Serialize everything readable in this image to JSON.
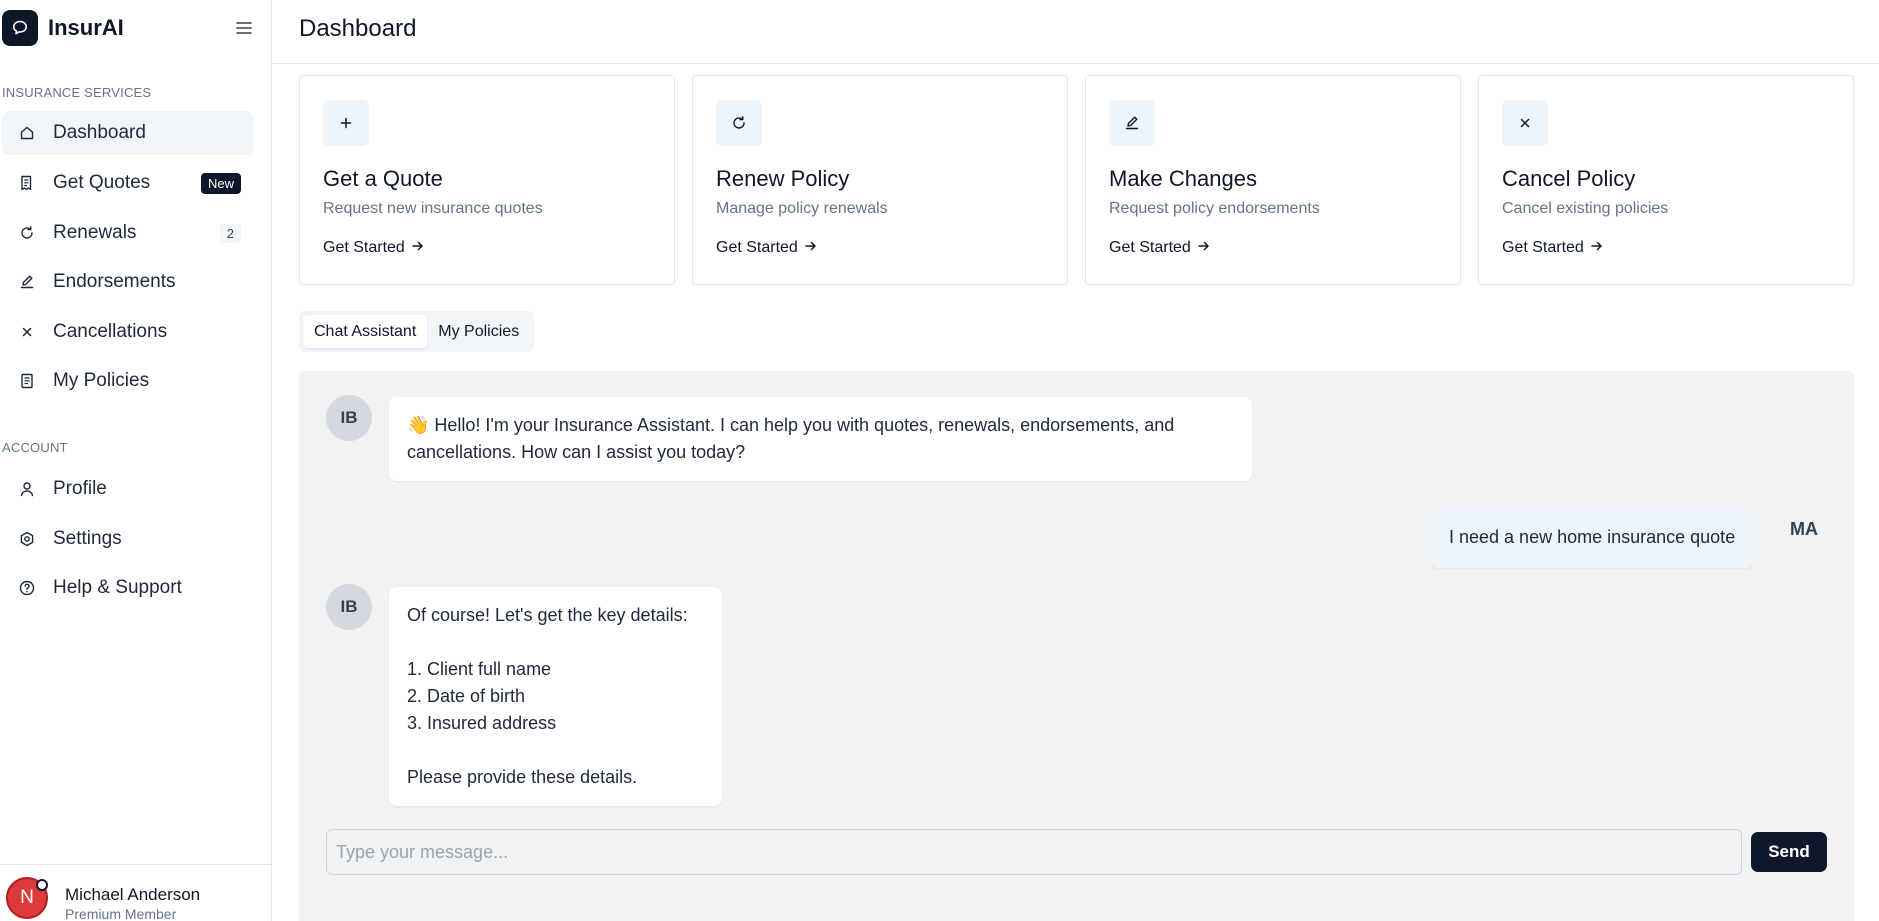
{
  "app": {
    "name": "InsurAI"
  },
  "sidebar": {
    "sections": [
      {
        "label": "INSURANCE SERVICES"
      },
      {
        "label": "ACCOUNT"
      }
    ],
    "items": [
      {
        "label": "Dashboard",
        "icon": "home-icon"
      },
      {
        "label": "Get Quotes",
        "icon": "receipt-icon",
        "badge": "New"
      },
      {
        "label": "Renewals",
        "icon": "refresh-icon",
        "badge": "2"
      },
      {
        "label": "Endorsements",
        "icon": "pencil-icon"
      },
      {
        "label": "Cancellations",
        "icon": "x-icon"
      },
      {
        "label": "My Policies",
        "icon": "document-icon"
      },
      {
        "label": "Profile",
        "icon": "user-icon"
      },
      {
        "label": "Settings",
        "icon": "gear-icon"
      },
      {
        "label": "Help & Support",
        "icon": "help-circle-icon"
      }
    ],
    "active_item": "Dashboard",
    "user": {
      "initial": "N",
      "name": "Michael Anderson",
      "tier": "Premium Member"
    }
  },
  "header": {
    "title": "Dashboard"
  },
  "cards": [
    {
      "icon": "plus-icon",
      "title": "Get a Quote",
      "description": "Request new insurance quotes",
      "cta": "Get Started"
    },
    {
      "icon": "refresh-icon",
      "title": "Renew Policy",
      "description": "Manage policy renewals",
      "cta": "Get Started"
    },
    {
      "icon": "pencil-icon",
      "title": "Make Changes",
      "description": "Request policy endorsements",
      "cta": "Get Started"
    },
    {
      "icon": "x-icon",
      "title": "Cancel Policy",
      "description": "Cancel existing policies",
      "cta": "Get Started"
    }
  ],
  "tabs": [
    {
      "label": "Chat Assistant",
      "active": true
    },
    {
      "label": "My Policies",
      "active": false
    }
  ],
  "chat": {
    "messages": [
      {
        "from": "bot",
        "avatar": "IB",
        "text": "👋 Hello! I'm your Insurance Assistant. I can help you with quotes, renewals, endorsements, and cancellations. How can I assist you today?"
      },
      {
        "from": "user",
        "avatar": "MA",
        "text": "I need a new home insurance quote"
      },
      {
        "from": "bot",
        "avatar": "IB",
        "text": "Of course! Let's get the key details:\n\n1. Client full name\n2. Date of birth\n3. Insured address\n\nPlease provide these details."
      }
    ],
    "input_placeholder": "Type your message...",
    "input_value": "",
    "send_label": "Send"
  },
  "colors": {
    "primary": "#0f172a",
    "avatar_red": "#dc3b3b",
    "chat_bg": "#f1f2f4",
    "card_icon_bg": "#eef4fb"
  }
}
